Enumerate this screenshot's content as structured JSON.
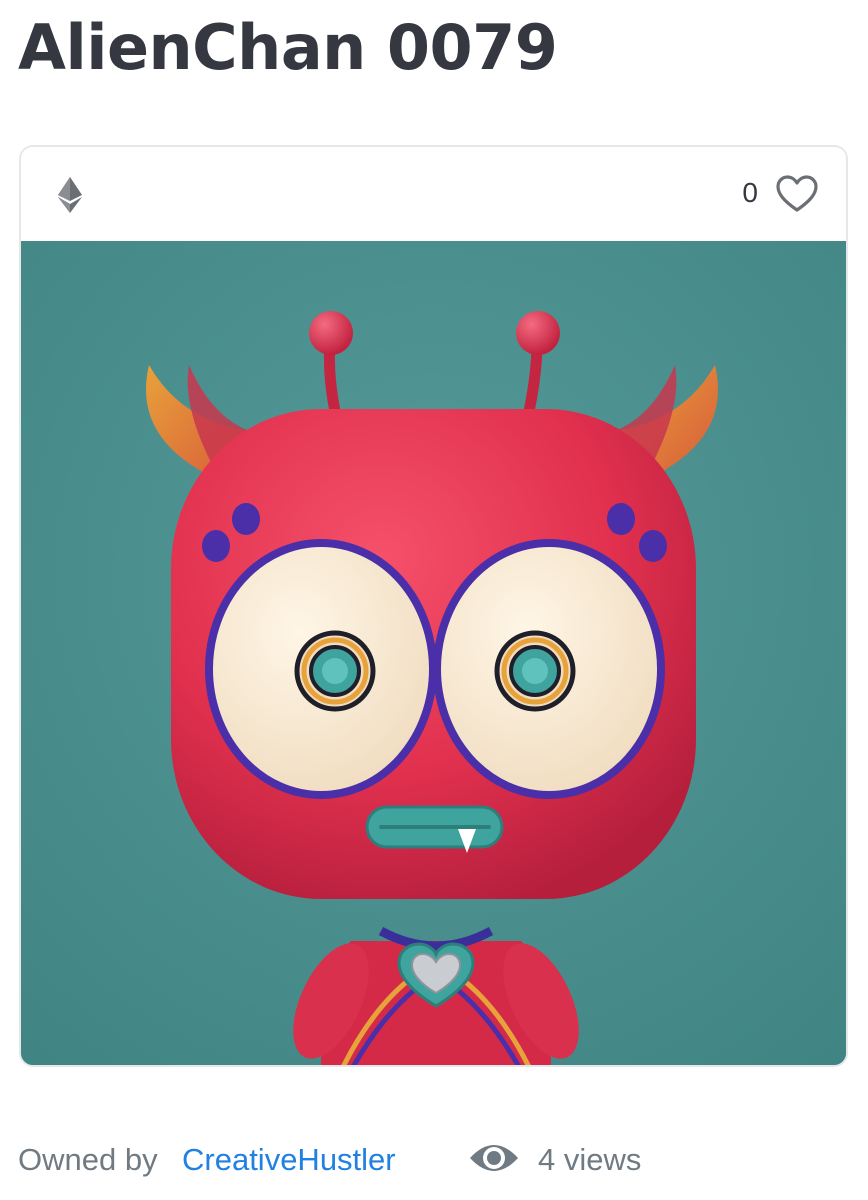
{
  "asset": {
    "title": "AlienChan 0079",
    "favorite_count": "0",
    "owned_by_label": "Owned by",
    "owner_name": "CreativeHustler",
    "views": "4 views"
  },
  "icons": {
    "chain": "ethereum-icon",
    "favorite": "heart-outline-icon",
    "views": "eye-icon"
  },
  "colors": {
    "title": "#353840",
    "link": "#2081e2",
    "muted": "#707a83",
    "artwork_background": "#4b9090",
    "character_body": "#e0304e"
  }
}
